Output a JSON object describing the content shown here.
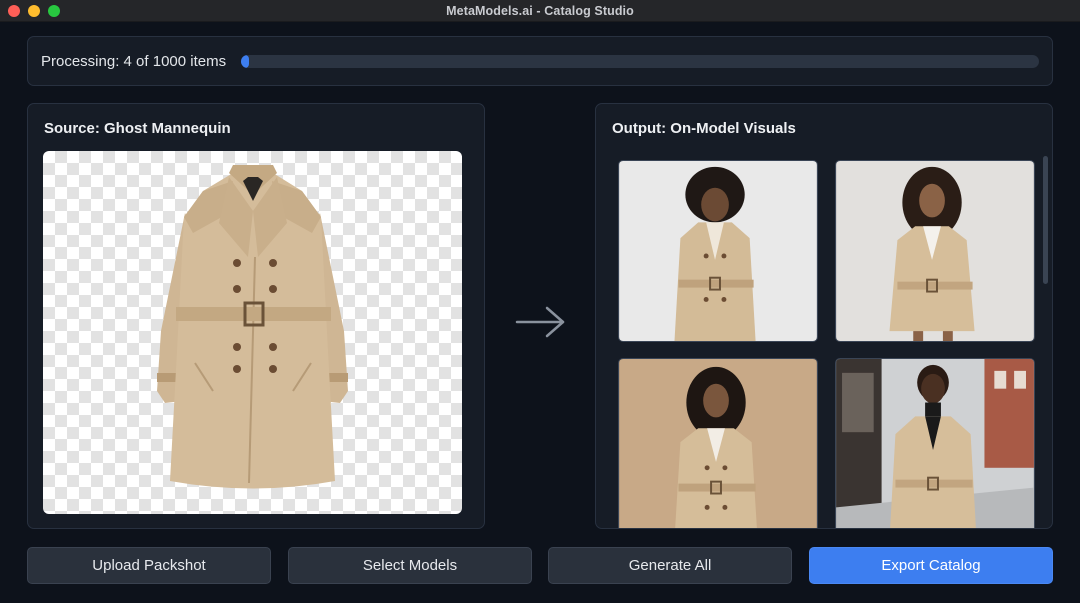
{
  "window": {
    "title": "MetaModels.ai - Catalog Studio"
  },
  "progress": {
    "label": "Processing: 4 of 1000 items",
    "current": 4,
    "total": 1000
  },
  "source": {
    "title": "Source: Ghost Mannequin",
    "icon": "coat-image"
  },
  "output": {
    "title": "Output: On-Model Visuals",
    "tiles": [
      {
        "icon": "model-image"
      },
      {
        "icon": "model-image"
      },
      {
        "icon": "model-image"
      },
      {
        "icon": "model-image"
      }
    ]
  },
  "actions": {
    "upload": "Upload Packshot",
    "select_models": "Select Models",
    "generate": "Generate All",
    "export": "Export Catalog"
  },
  "colors": {
    "accent": "#3d7ef0",
    "background": "#0d121b",
    "panel": "#161c26",
    "coat": "#d4bc9a"
  }
}
